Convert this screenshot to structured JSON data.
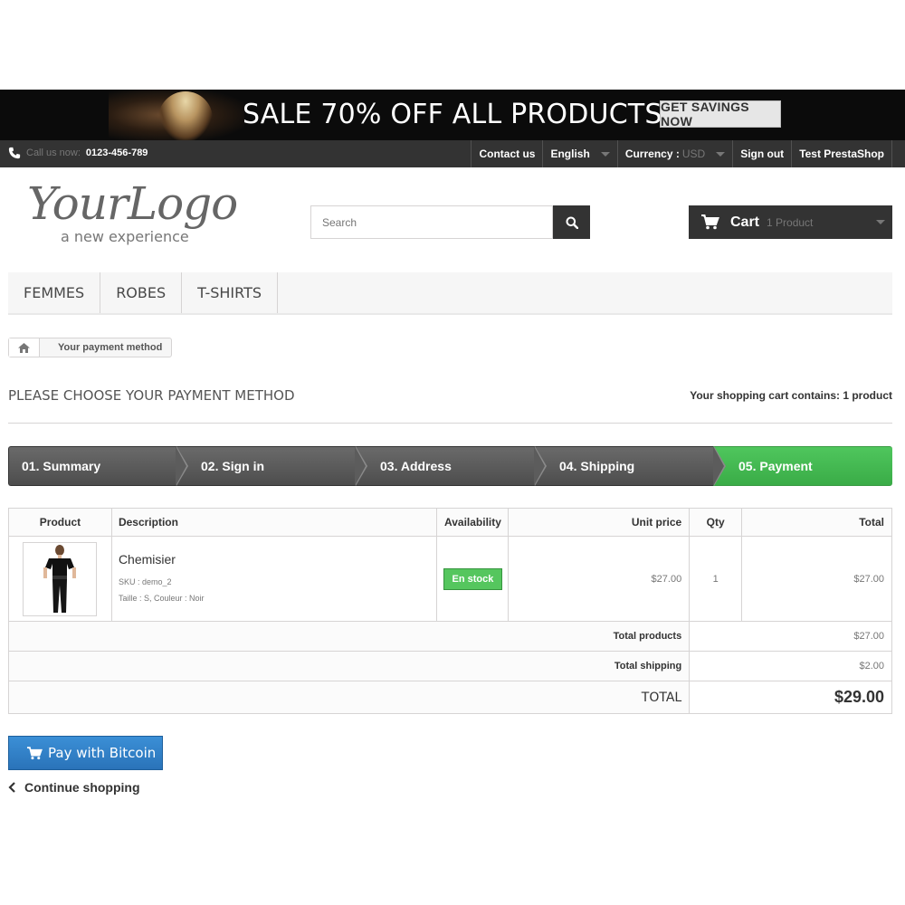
{
  "banner": {
    "headline": "SALE 70% OFF ALL PRODUCTS",
    "cta": "GET SAVINGS NOW"
  },
  "topbar": {
    "call_label": "Call us now:",
    "phone": "0123-456-789",
    "contact": "Contact us",
    "language": "English",
    "currency_label": "Currency :",
    "currency_value": "USD",
    "sign_out": "Sign out",
    "user": "Test PrestaShop"
  },
  "header": {
    "logo_main": "YourLogo",
    "logo_sub": "a new experience",
    "search_placeholder": "Search",
    "cart_label": "Cart",
    "cart_count": "1 Product"
  },
  "menu": [
    "FEMMES",
    "ROBES",
    "T-SHIRTS"
  ],
  "breadcrumb": {
    "current": "Your payment method"
  },
  "page": {
    "heading": "PLEASE CHOOSE YOUR PAYMENT METHOD",
    "cart_contains": "Your shopping cart contains: 1 product"
  },
  "steps": [
    "01. Summary",
    "02. Sign in",
    "03. Address",
    "04. Shipping",
    "05. Payment"
  ],
  "table": {
    "headers": {
      "product": "Product",
      "description": "Description",
      "availability": "Availability",
      "unit_price": "Unit price",
      "qty": "Qty",
      "total": "Total"
    },
    "item": {
      "name": "Chemisier",
      "sku": "SKU : demo_2",
      "attributes": "Taille : S, Couleur : Noir",
      "availability": "En stock",
      "unit_price": "$27.00",
      "qty": "1",
      "total": "$27.00"
    },
    "total_products_label": "Total products",
    "total_products": "$27.00",
    "total_shipping_label": "Total shipping",
    "total_shipping": "$2.00",
    "total_label": "TOTAL",
    "total": "$29.00"
  },
  "actions": {
    "pay": "Pay with Bitcoin",
    "continue": "Continue shopping"
  }
}
